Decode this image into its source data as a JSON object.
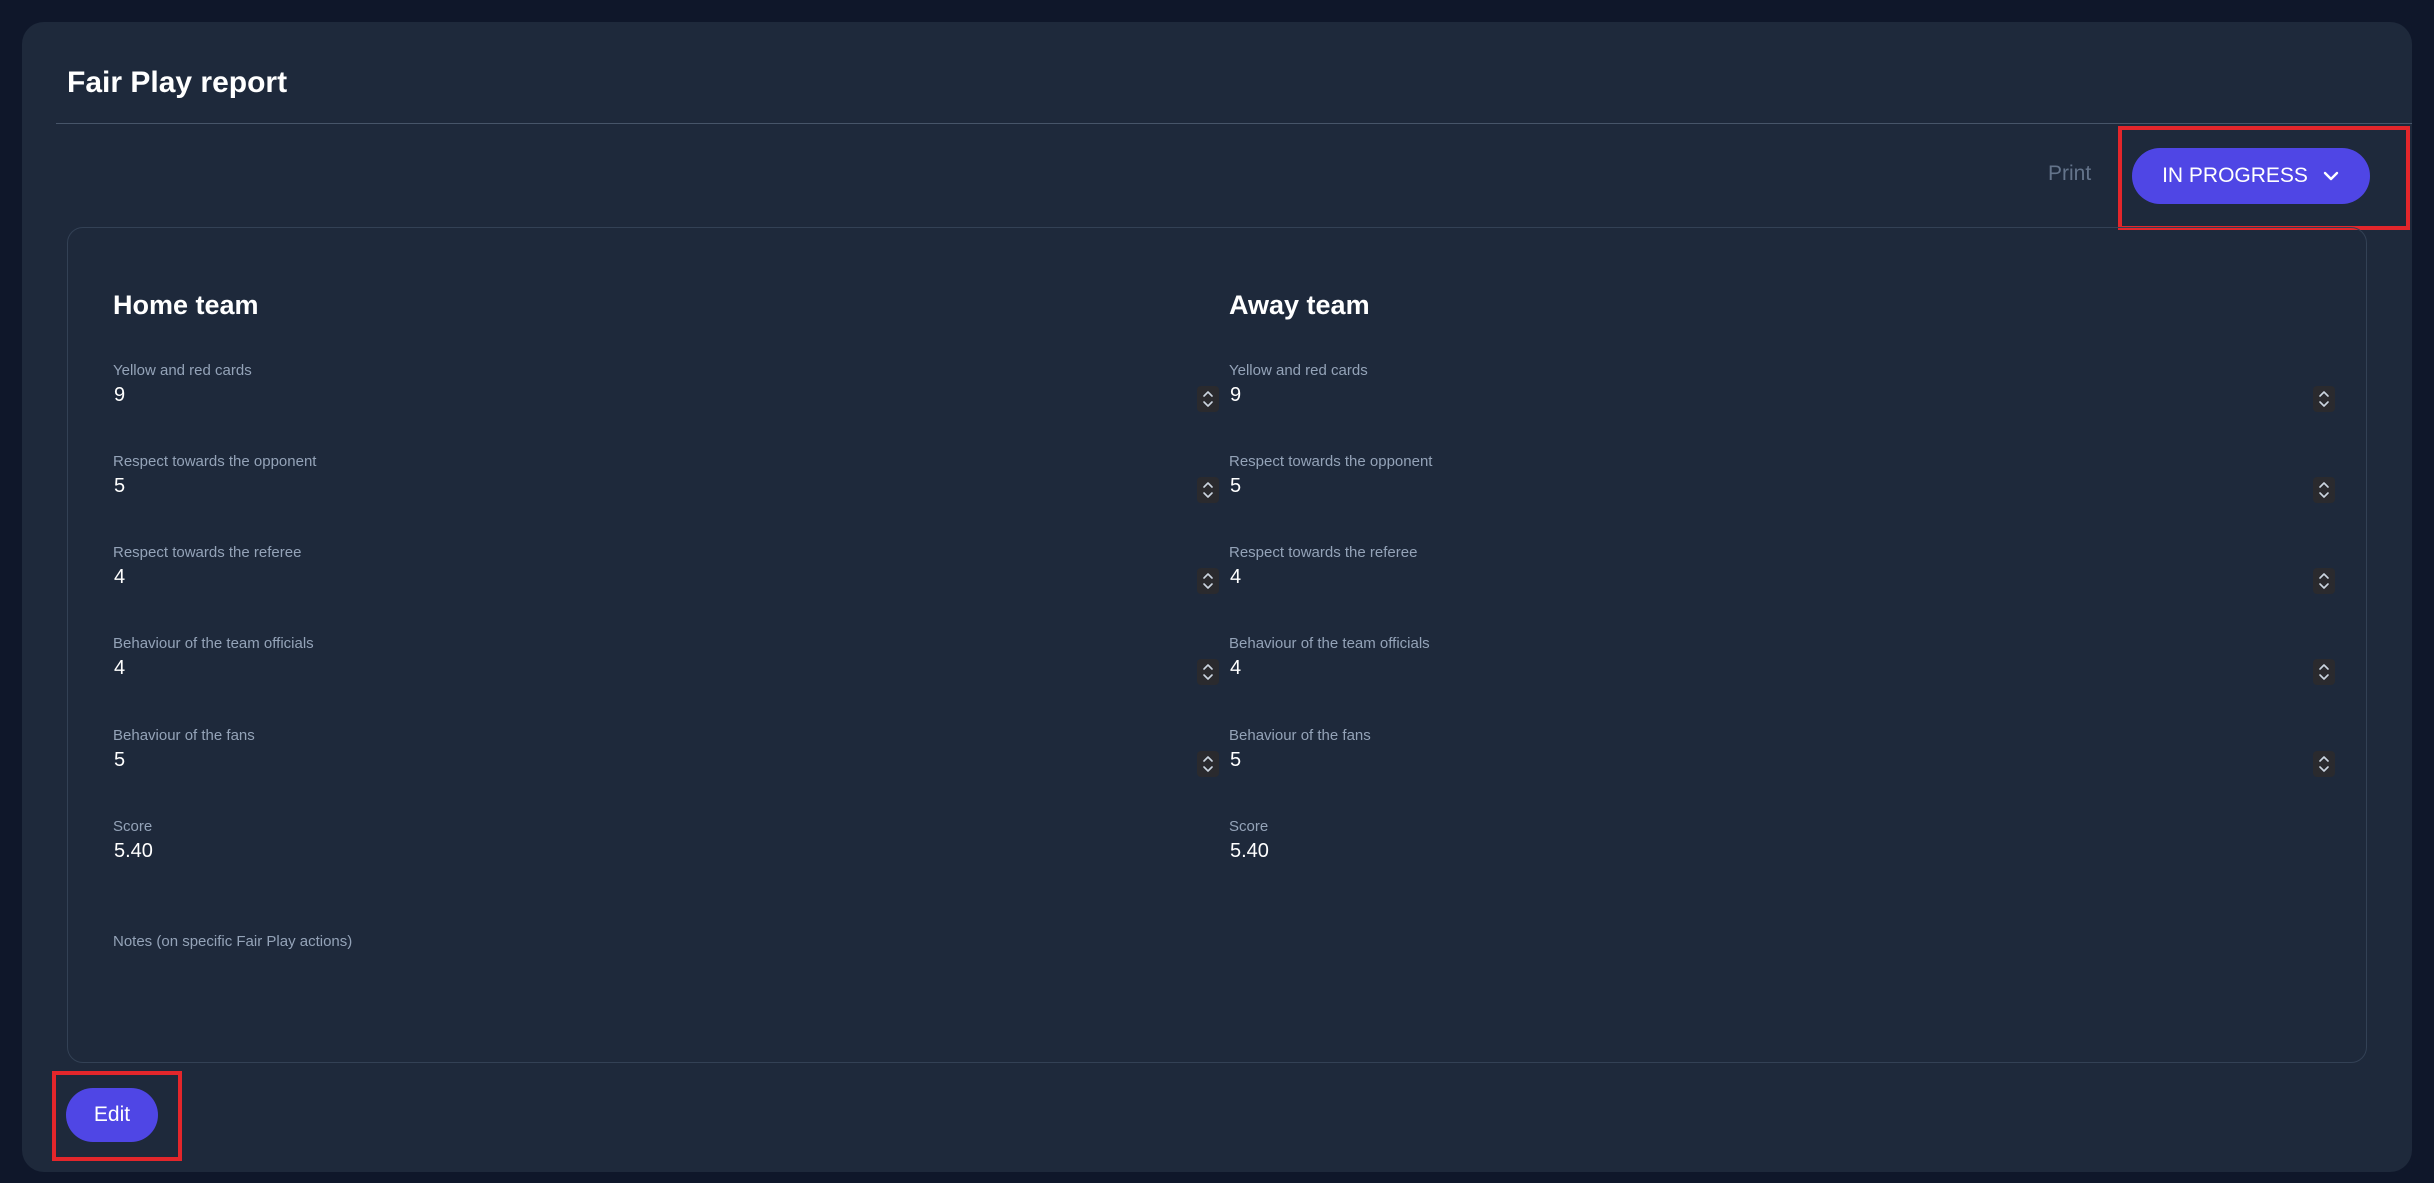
{
  "page": {
    "title": "Fair Play report"
  },
  "toolbar": {
    "print_label": "Print",
    "status_label": "IN PROGRESS"
  },
  "home": {
    "title": "Home team",
    "fields": [
      {
        "label": "Yellow and red cards",
        "value": "9"
      },
      {
        "label": "Respect towards the opponent",
        "value": "5"
      },
      {
        "label": "Respect towards the referee",
        "value": "4"
      },
      {
        "label": "Behaviour of the team officials",
        "value": "4"
      },
      {
        "label": "Behaviour of the fans",
        "value": "5"
      }
    ],
    "score_label": "Score",
    "score_value": "5.40"
  },
  "away": {
    "title": "Away team",
    "fields": [
      {
        "label": "Yellow and red cards",
        "value": "9"
      },
      {
        "label": "Respect towards the opponent",
        "value": "5"
      },
      {
        "label": "Respect towards the referee",
        "value": "4"
      },
      {
        "label": "Behaviour of the team officials",
        "value": "4"
      },
      {
        "label": "Behaviour of the fans",
        "value": "5"
      }
    ],
    "score_label": "Score",
    "score_value": "5.40"
  },
  "notes": {
    "label": "Notes (on specific Fair Play actions)"
  },
  "footer": {
    "edit_label": "Edit"
  },
  "colors": {
    "accent": "#4f46e5",
    "highlight": "#e3262b",
    "background": "#0f172a",
    "card": "#1e293b"
  }
}
